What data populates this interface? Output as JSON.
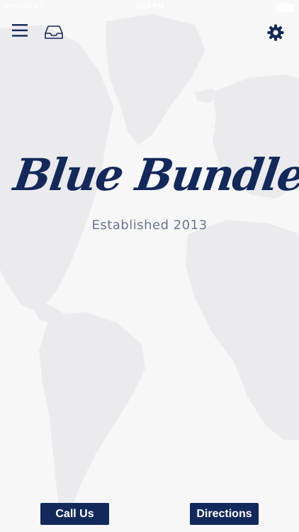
{
  "status_bar": {
    "carrier": "•••○○ AT&T",
    "time": "3:19 PM"
  },
  "header": {
    "icons": [
      "menu-icon",
      "inbox-icon",
      "gear-icon"
    ]
  },
  "brand": {
    "name": "Blue Bundles",
    "tagline": "Established 2013",
    "color": "#13295c"
  },
  "actions": {
    "call_label": "Call Us",
    "directions_label": "Directions"
  },
  "colors": {
    "primary": "#13295c",
    "background": "#f7f7f8",
    "map_land": "#ebebed"
  }
}
